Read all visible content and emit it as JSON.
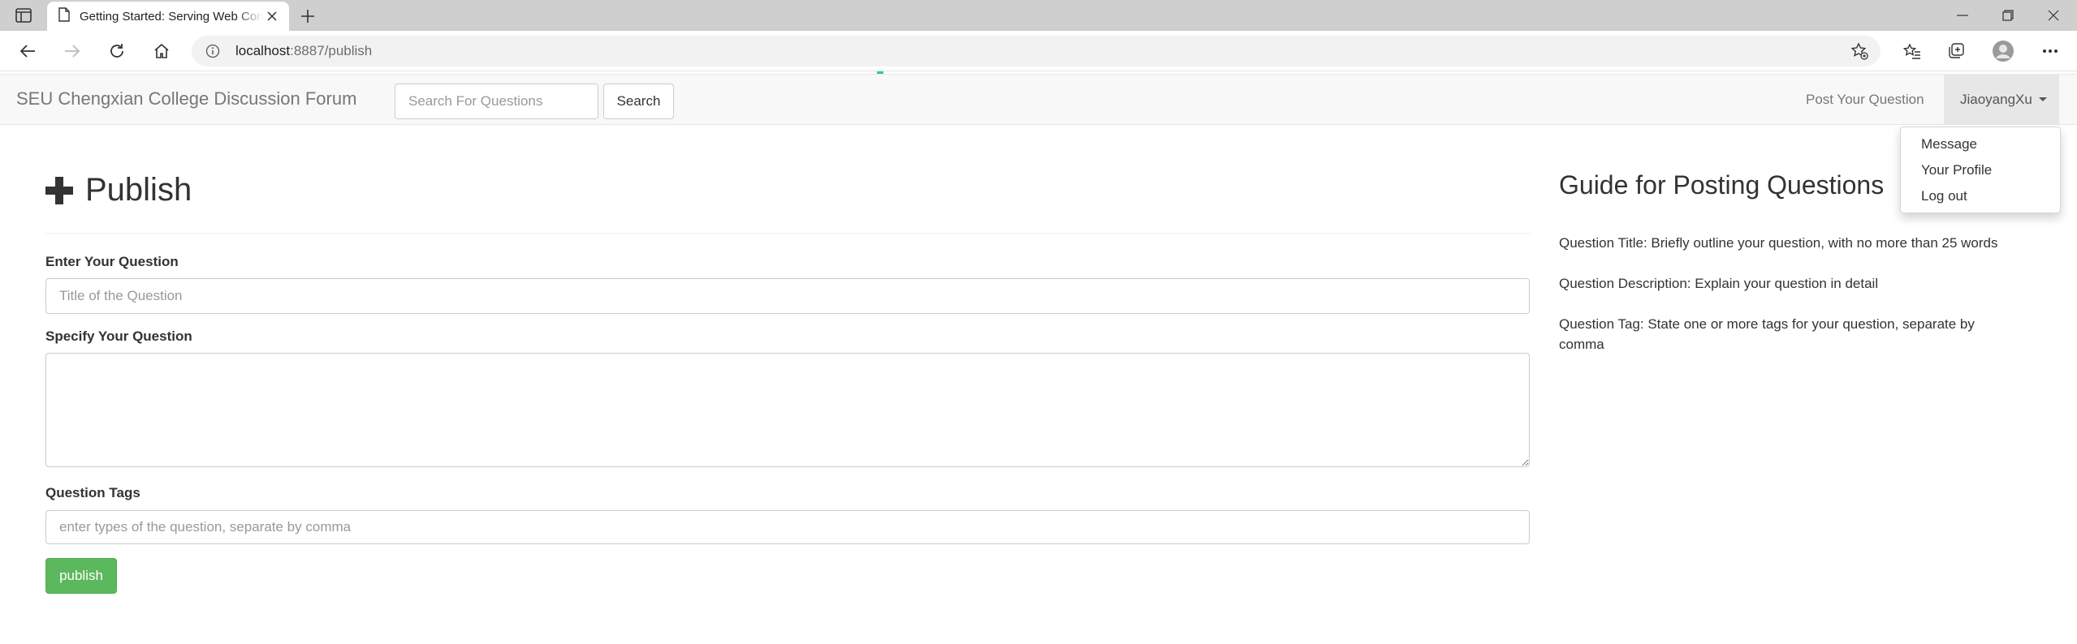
{
  "browser": {
    "tab_title": "Getting Started: Serving Web Content",
    "url_host": "localhost",
    "url_path": ":8887/publish"
  },
  "navbar": {
    "brand": "SEU Chengxian College Discussion Forum",
    "search_placeholder": "Search For Questions",
    "search_button": "Search",
    "post_link": "Post Your Question",
    "user_name": "JiaoyangXu"
  },
  "user_menu": {
    "items": [
      {
        "label": "Message"
      },
      {
        "label": "Your Profile"
      },
      {
        "label": "Log out"
      }
    ]
  },
  "form": {
    "title": "Publish",
    "question_label": "Enter Your Question",
    "question_placeholder": "Title of the Question",
    "question_value": "",
    "description_label": "Specify Your Question",
    "description_value": "",
    "tags_label": "Question Tags",
    "tags_placeholder": "enter types of the question, separate by comma",
    "tags_value": "",
    "publish_button": "publish"
  },
  "guide": {
    "title": "Guide for Posting Questions",
    "items": [
      "Question Title: Briefly outline your question, with no more than 25 words",
      "Question Description: Explain your question in detail",
      "Question Tag: State one or more tags for your question, separate by comma"
    ]
  },
  "colors": {
    "publish_green": "#5cb85c",
    "navbar_bg": "#f8f8f8",
    "active_user_bg": "#e7e7e7"
  },
  "icons": [
    "tab-actions-icon",
    "page-icon",
    "close-icon",
    "new-tab-icon",
    "minimize-icon",
    "restore-icon",
    "window-close-icon",
    "back-icon",
    "forward-icon",
    "reload-icon",
    "home-icon",
    "info-icon",
    "favorite-add-icon",
    "favorites-icon",
    "collections-icon",
    "profile-icon",
    "more-icon",
    "plus-icon"
  ]
}
